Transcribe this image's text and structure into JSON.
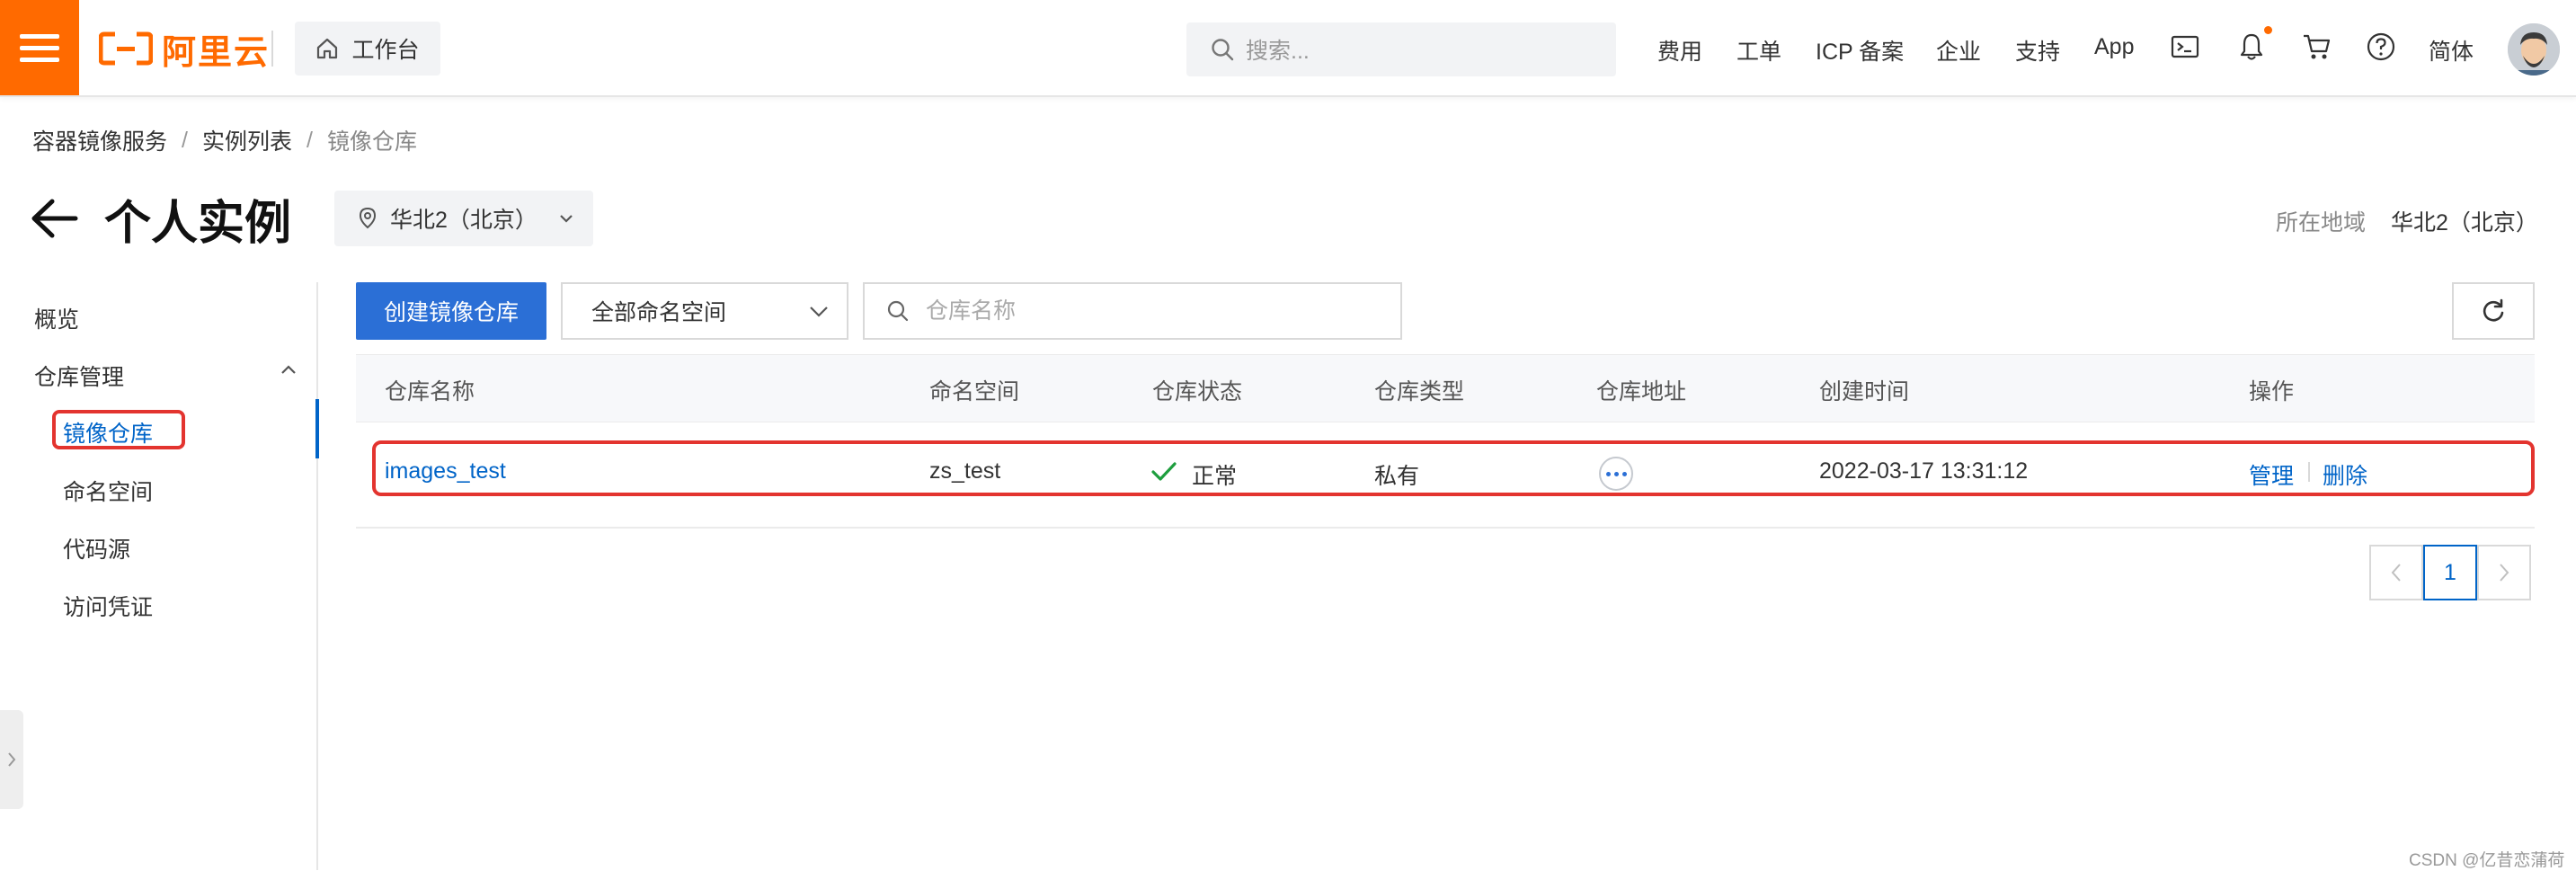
{
  "topbar": {
    "logo_text": "阿里云",
    "workbench_label": "工作台",
    "search_placeholder": "搜索...",
    "nav": {
      "fees": "费用",
      "tickets": "工单",
      "icp": "ICP 备案",
      "enterprise": "企业",
      "support": "支持",
      "app": "App",
      "language": "简体"
    }
  },
  "breadcrumb": [
    "容器镜像服务",
    "实例列表",
    "镜像仓库"
  ],
  "breadcrumb_separator": "/",
  "title_row": {
    "title": "个人实例",
    "region_select": "华北2（北京）",
    "region_label": "所在地域",
    "region_value": "华北2（北京）"
  },
  "sidebar": {
    "overview": "概览",
    "repo_management": "仓库管理",
    "items": [
      "镜像仓库",
      "命名空间",
      "代码源",
      "访问凭证"
    ]
  },
  "toolbar": {
    "create_button": "创建镜像仓库",
    "namespace_select": "全部命名空间",
    "search_placeholder": "仓库名称"
  },
  "table": {
    "columns": [
      "仓库名称",
      "命名空间",
      "仓库状态",
      "仓库类型",
      "仓库地址",
      "创建时间",
      "操作"
    ],
    "rows": [
      {
        "name": "images_test",
        "namespace": "zs_test",
        "status": "正常",
        "type": "私有",
        "created": "2022-03-17 13:31:12",
        "actions": [
          "管理",
          "删除"
        ]
      }
    ]
  },
  "pagination": {
    "current_page": "1"
  },
  "watermark": "CSDN @亿昔恋蒲荷",
  "colors": {
    "brand_orange": "#ff6a00",
    "primary_blue": "#2b6fd6",
    "link_blue": "#0064c8",
    "highlight_red": "#e3342f",
    "success_green": "#1e9e3e"
  }
}
